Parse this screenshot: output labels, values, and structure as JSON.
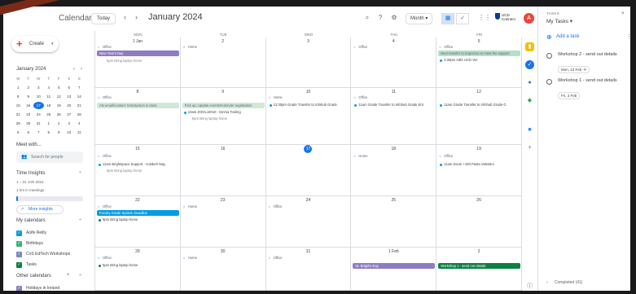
{
  "app": {
    "title": "Calendar"
  },
  "header": {
    "today_label": "Today",
    "prev_icon": "chevron-left-icon",
    "next_icon": "chevron-right-icon",
    "month_title": "January 2024",
    "view_label": "Month",
    "org_line1": "UCD",
    "org_line2": "Connect",
    "avatar_letter": "A"
  },
  "sidebar": {
    "create_label": "Create",
    "mini_month": "January 2024",
    "mini_headers": [
      "M",
      "T",
      "W",
      "T",
      "F",
      "S",
      "S"
    ],
    "mini_days": [
      [
        "1",
        "2",
        "3",
        "4",
        "5",
        "6",
        "7"
      ],
      [
        "8",
        "9",
        "10",
        "11",
        "12",
        "13",
        "14"
      ],
      [
        "15",
        "16",
        "17",
        "18",
        "19",
        "20",
        "21"
      ],
      [
        "22",
        "23",
        "24",
        "25",
        "26",
        "27",
        "28"
      ],
      [
        "29",
        "30",
        "31",
        "1",
        "2",
        "3",
        "4"
      ],
      [
        "5",
        "6",
        "7",
        "8",
        "9",
        "10",
        "11"
      ]
    ],
    "meet_with": "Meet with...",
    "search_people": "Search for people",
    "time_insights": "Time Insights",
    "insights_range": "1 – 31 JAN 2024",
    "insights_hours": "1 hrs in meetings",
    "insights_fraction": 0.03,
    "more_insights": "More insights",
    "my_calendars": "My calendars",
    "calendars": [
      {
        "name": "Aoife Reilly",
        "color": "#039be5"
      },
      {
        "name": "Birthdays",
        "color": "#33b679"
      },
      {
        "name": "CoS EdTech Workshops",
        "color": "#7986cb"
      },
      {
        "name": "Tasks",
        "color": "#0b8043"
      }
    ],
    "other_calendars": "Other calendars",
    "other": [
      {
        "name": "Holidays in Ireland",
        "color": "#8e7cc3"
      }
    ]
  },
  "grid": {
    "dow": [
      "MON",
      "TUE",
      "WED",
      "THU",
      "FRI"
    ],
    "weeks": [
      [
        "1 Jan",
        "2",
        "3",
        "4",
        "5"
      ],
      [
        "8",
        "9",
        "10",
        "11",
        "12"
      ],
      [
        "15",
        "16",
        "17",
        "18",
        "19"
      ],
      [
        "22",
        "23",
        "24",
        "25",
        "26"
      ],
      [
        "29",
        "30",
        "31",
        "1 Feb",
        "2"
      ]
    ],
    "labels": {
      "office": "Office",
      "home": "Home",
      "new_year": "New Year's Day",
      "bring_laptop": "Bring laptop home",
      "bring_laptop_5pm": "5pm Bring laptop home",
      "time_5pm": "5pm",
      "next_transfer": "Next transfer to Exprezzo to meet the support",
      "adfe": "2:30pm Adfe UCD Vet",
      "w2_ghost1": "AN email/contact: Introduction & class",
      "w2_ghost2": "Pick up: Update events/reminder registration",
      "eolm": "10am ZOOL10010 - Emma Tooling",
      "grade_1230": "12:30pm Grade Transfer to Infohub Grade",
      "grade_11_thu": "11am Grade Transfer to Infohub Grade Ent",
      "grade_11_fri": "11am Grade Transfer to Infohub Grade G",
      "brightspace": "11am Brightspace Support - Aoisbeh Nag",
      "zoom_pasta": "11am Zoom +100 Pasta Valentini",
      "faculty_grade": "Faculty Grade System Deadline",
      "bring_laptop_9pm": "9pm Bring laptop home",
      "bring_laptop_5pm_b": "5pm Bring laptop home",
      "st_brigids": "St. Brigid's Day",
      "workshop_1": "Workshop 1 - send out details"
    }
  },
  "rail": {
    "icons": [
      "keep-icon",
      "tasks-icon",
      "contacts-icon",
      "maps-icon",
      "zoom-icon",
      "add-icon"
    ]
  },
  "tasks": {
    "label": "TASKS",
    "list_name": "My Tasks",
    "add_task": "Add a task",
    "items": [
      {
        "title": "Workshop 2 - send out details",
        "date": "Mon, 12 Feb"
      },
      {
        "title": "Workshop 1 - send out details",
        "date": "Fri, 2 Feb"
      }
    ],
    "completed": "Completed (41)"
  }
}
